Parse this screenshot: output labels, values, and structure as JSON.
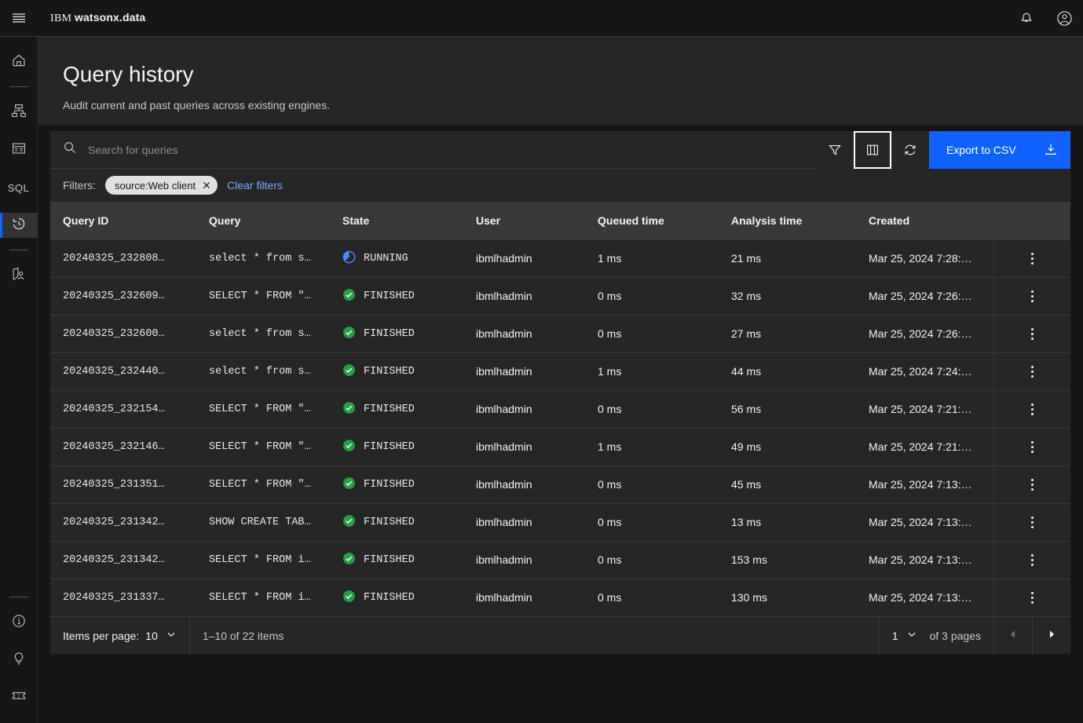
{
  "header": {
    "menu_icon": "hamburger-menu-icon",
    "brand_prefix": "IBM",
    "brand_name": "watsonx.data",
    "notifications_icon": "bell-icon",
    "account_icon": "user-avatar-icon"
  },
  "sidebar": {
    "items": [
      {
        "name": "home",
        "icon": "home-icon",
        "active": false
      },
      {
        "name": "infrastructure-manager",
        "icon": "infrastructure-icon",
        "active": false
      },
      {
        "name": "data-manager",
        "icon": "data-manager-icon",
        "active": false
      },
      {
        "name": "query-workspace",
        "icon": "sql-icon",
        "label": "SQL",
        "active": false
      },
      {
        "name": "query-history",
        "icon": "query-history-clock-icon",
        "active": true
      },
      {
        "name": "access-control",
        "icon": "access-control-icon",
        "active": false
      }
    ],
    "bottom_items": [
      {
        "name": "information",
        "icon": "info-circle-icon"
      },
      {
        "name": "tips",
        "icon": "lightbulb-icon"
      },
      {
        "name": "support-ticket",
        "icon": "ticket-icon"
      }
    ]
  },
  "page": {
    "title": "Query history",
    "subtitle": "Audit current and past queries across existing engines."
  },
  "toolbar": {
    "search_placeholder": "Search for queries",
    "search_value": "",
    "search_icon": "search-icon",
    "filter_icon": "filter-icon",
    "column_settings_icon": "column-settings-icon",
    "refresh_icon": "refresh-icon",
    "export_label": "Export to CSV",
    "export_icon": "download-icon"
  },
  "filters": {
    "label": "Filters:",
    "tags": [
      {
        "text": "source:Web client",
        "close_icon": "close-icon"
      }
    ],
    "clear_label": "Clear filters"
  },
  "table": {
    "columns": [
      "Query ID",
      "Query",
      "State",
      "User",
      "Queued time",
      "Analysis time",
      "Created"
    ],
    "rows": [
      {
        "query_id": "20240325_232808…",
        "query": "select * from s…",
        "state": "RUNNING",
        "state_icon": "running-progress-icon",
        "user": "ibmlhadmin",
        "queued_time": "1 ms",
        "analysis_time": "21 ms",
        "created": "Mar 25, 2024 7:28:…",
        "overflow_icon": "overflow-menu-icon"
      },
      {
        "query_id": "20240325_232609…",
        "query": "SELECT * FROM \"…",
        "state": "FINISHED",
        "state_icon": "checkmark-filled-icon",
        "user": "ibmlhadmin",
        "queued_time": "0 ms",
        "analysis_time": "32 ms",
        "created": "Mar 25, 2024 7:26:…",
        "overflow_icon": "overflow-menu-icon"
      },
      {
        "query_id": "20240325_232600…",
        "query": "select * from s…",
        "state": "FINISHED",
        "state_icon": "checkmark-filled-icon",
        "user": "ibmlhadmin",
        "queued_time": "0 ms",
        "analysis_time": "27 ms",
        "created": "Mar 25, 2024 7:26:…",
        "overflow_icon": "overflow-menu-icon"
      },
      {
        "query_id": "20240325_232440…",
        "query": "select * from s…",
        "state": "FINISHED",
        "state_icon": "checkmark-filled-icon",
        "user": "ibmlhadmin",
        "queued_time": "1 ms",
        "analysis_time": "44 ms",
        "created": "Mar 25, 2024 7:24:…",
        "overflow_icon": "overflow-menu-icon"
      },
      {
        "query_id": "20240325_232154…",
        "query": "SELECT * FROM \"…",
        "state": "FINISHED",
        "state_icon": "checkmark-filled-icon",
        "user": "ibmlhadmin",
        "queued_time": "0 ms",
        "analysis_time": "56 ms",
        "created": "Mar 25, 2024 7:21:…",
        "overflow_icon": "overflow-menu-icon"
      },
      {
        "query_id": "20240325_232146…",
        "query": "SELECT * FROM \"…",
        "state": "FINISHED",
        "state_icon": "checkmark-filled-icon",
        "user": "ibmlhadmin",
        "queued_time": "1 ms",
        "analysis_time": "49 ms",
        "created": "Mar 25, 2024 7:21:…",
        "overflow_icon": "overflow-menu-icon"
      },
      {
        "query_id": "20240325_231351…",
        "query": "SELECT * FROM \"…",
        "state": "FINISHED",
        "state_icon": "checkmark-filled-icon",
        "user": "ibmlhadmin",
        "queued_time": "0 ms",
        "analysis_time": "45 ms",
        "created": "Mar 25, 2024 7:13:…",
        "overflow_icon": "overflow-menu-icon"
      },
      {
        "query_id": "20240325_231342…",
        "query": "SHOW CREATE TAB…",
        "state": "FINISHED",
        "state_icon": "checkmark-filled-icon",
        "user": "ibmlhadmin",
        "queued_time": "0 ms",
        "analysis_time": "13 ms",
        "created": "Mar 25, 2024 7:13:…",
        "overflow_icon": "overflow-menu-icon"
      },
      {
        "query_id": "20240325_231342…",
        "query": "SELECT * FROM i…",
        "state": "FINISHED",
        "state_icon": "checkmark-filled-icon",
        "user": "ibmlhadmin",
        "queued_time": "0 ms",
        "analysis_time": "153 ms",
        "created": "Mar 25, 2024 7:13:…",
        "overflow_icon": "overflow-menu-icon"
      },
      {
        "query_id": "20240325_231337…",
        "query": "SELECT * FROM i…",
        "state": "FINISHED",
        "state_icon": "checkmark-filled-icon",
        "user": "ibmlhadmin",
        "queued_time": "0 ms",
        "analysis_time": "130 ms",
        "created": "Mar 25, 2024 7:13:…",
        "overflow_icon": "overflow-menu-icon"
      }
    ]
  },
  "pagination": {
    "items_per_page_label": "Items per page:",
    "items_per_page_value": "10",
    "range_label": "1–10 of 22 items",
    "page_value": "1",
    "pages_label": "of 3 pages",
    "prev_icon": "caret-left-icon",
    "next_icon": "caret-right-icon",
    "prev_disabled": true,
    "next_disabled": false
  },
  "colors": {
    "accent_blue": "#0f62fe",
    "link_blue": "#78a9ff",
    "success_green": "#24a148",
    "running_blue": "#4589ff",
    "header_row": "#393939",
    "surface": "#262626",
    "background": "#161616"
  }
}
